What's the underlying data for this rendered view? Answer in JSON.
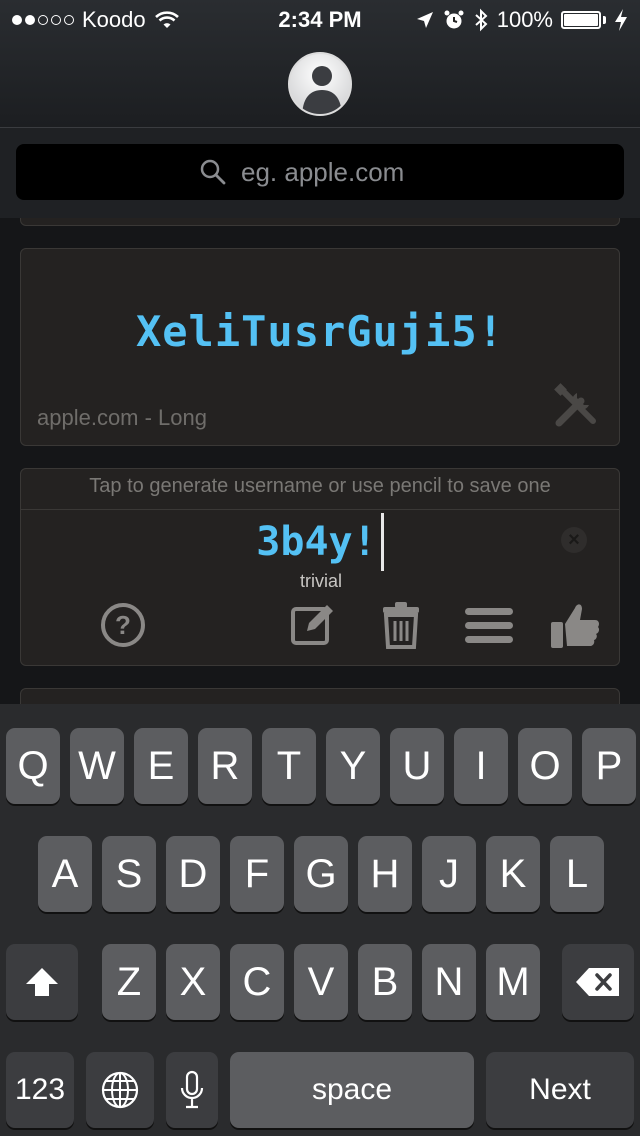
{
  "status_bar": {
    "carrier": "Koodo",
    "time": "2:34 PM",
    "battery": "100%",
    "signal_bars_filled": 2,
    "signal_bars_total": 5,
    "battery_level": 1.0
  },
  "header": {
    "avatar_icon": "user-silhouette-icon"
  },
  "search": {
    "placeholder": "eg. apple.com",
    "icon": "search-icon"
  },
  "password_card": {
    "password": "XeliTusrGuji5!",
    "site_label": "apple.com - Long",
    "tools_icon": "wrench-screwdriver-icon"
  },
  "username_card": {
    "hint": "Tap to generate username or use pencil to save one",
    "username": "3b4y!",
    "strength": "trivial",
    "toolbar_icons": [
      "help-icon",
      "edit-icon",
      "trash-icon",
      "menu-icon",
      "thumbs-up-icon"
    ]
  },
  "keyboard": {
    "row1": [
      "Q",
      "W",
      "E",
      "R",
      "T",
      "Y",
      "U",
      "I",
      "O",
      "P"
    ],
    "row2": [
      "A",
      "S",
      "D",
      "F",
      "G",
      "H",
      "J",
      "K",
      "L"
    ],
    "row3": [
      "Z",
      "X",
      "C",
      "V",
      "B",
      "N",
      "M"
    ],
    "numbers_label": "123",
    "space_label": "space",
    "next_label": "Next"
  },
  "colors": {
    "accent": "#54c1f4",
    "card_bg": "#242221",
    "key_bg": "#5c5d60",
    "keyboard_bg": "#2a2b2d"
  }
}
